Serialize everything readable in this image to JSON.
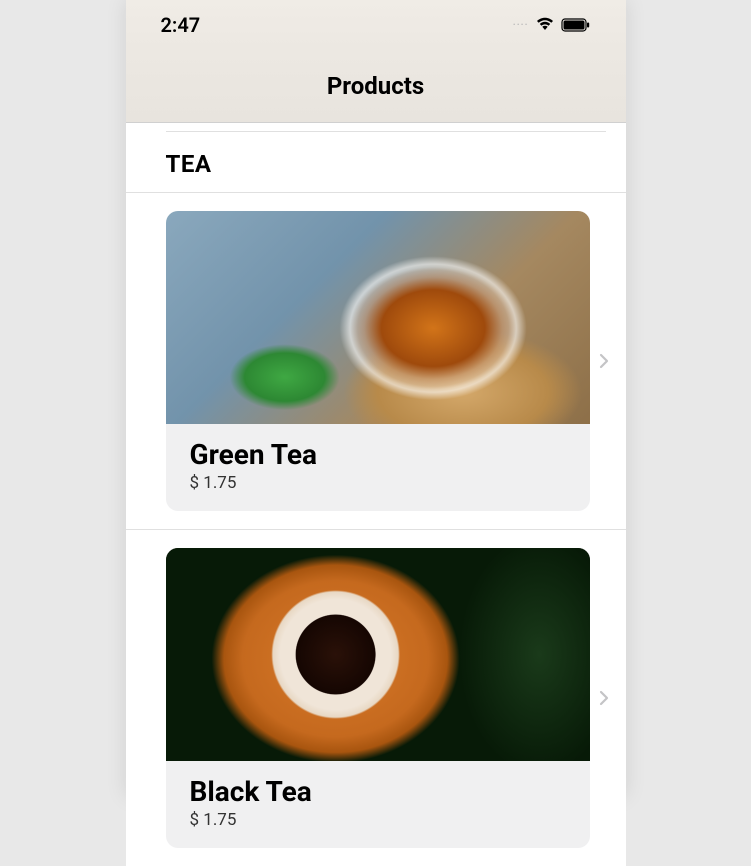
{
  "status_bar": {
    "time": "2:47",
    "signal_dots": "····"
  },
  "nav": {
    "title": "Products"
  },
  "section": {
    "header": "TEA"
  },
  "products": [
    {
      "name": "Green Tea",
      "price": "$ 1.75",
      "image_name": "green-tea-image"
    },
    {
      "name": "Black Tea",
      "price": "$ 1.75",
      "image_name": "black-tea-image"
    }
  ]
}
